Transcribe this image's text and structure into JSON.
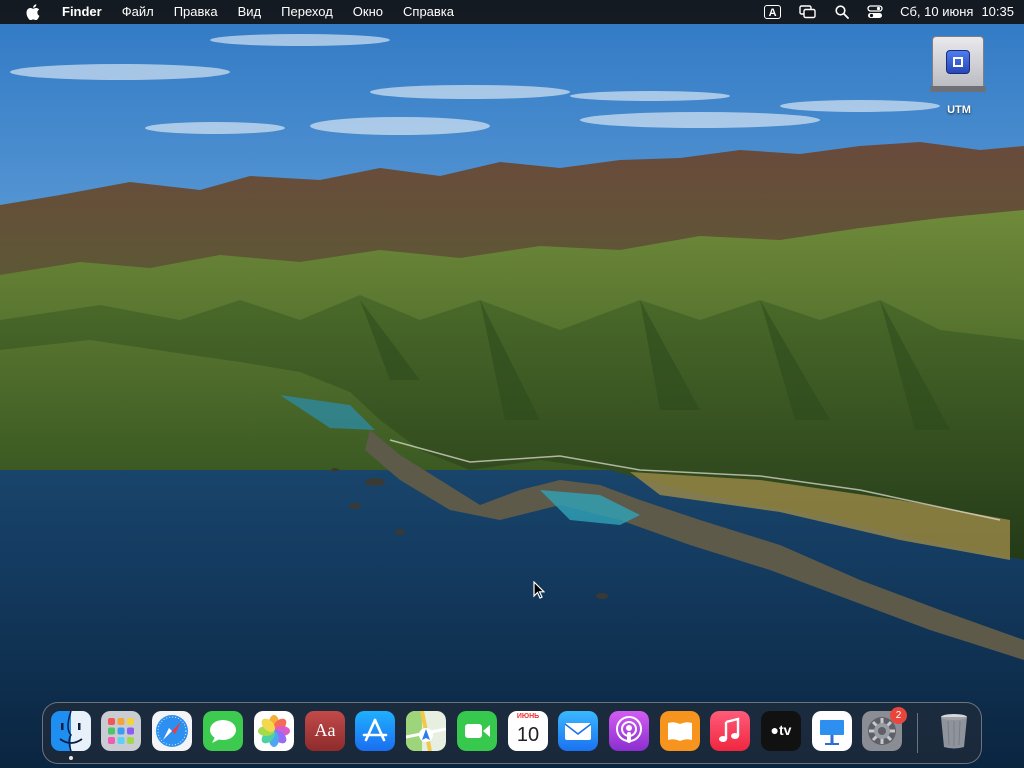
{
  "menubar": {
    "app_name": "Finder",
    "menus": [
      "Файл",
      "Правка",
      "Вид",
      "Переход",
      "Окно",
      "Справка"
    ],
    "input_source": "A",
    "date": "Сб, 10 июня",
    "time": "10:35",
    "icons": [
      "apple-icon",
      "keyboard-input-icon",
      "screen-mirroring-icon",
      "search-icon",
      "control-center-icon"
    ]
  },
  "desktop": {
    "drive_label": "UTM"
  },
  "dock": {
    "items": [
      {
        "name": "finder",
        "running": true
      },
      {
        "name": "launchpad"
      },
      {
        "name": "safari"
      },
      {
        "name": "messages"
      },
      {
        "name": "photos"
      },
      {
        "name": "dictionary",
        "glyph": "Aa"
      },
      {
        "name": "app-store"
      },
      {
        "name": "maps"
      },
      {
        "name": "facetime"
      },
      {
        "name": "calendar",
        "month": "ИЮНЬ",
        "day": "10"
      },
      {
        "name": "mail"
      },
      {
        "name": "podcasts"
      },
      {
        "name": "books"
      },
      {
        "name": "music"
      },
      {
        "name": "apple-tv",
        "glyph": "tv"
      },
      {
        "name": "keynote"
      },
      {
        "name": "system-preferences",
        "badge": "2"
      },
      {
        "name": "trash"
      }
    ]
  },
  "colors": {
    "menubar_bg": "#121214",
    "sky": "#4a8fd0",
    "ocean": "#0f3457",
    "mountains": "#4f6b2e",
    "badge": "#e8453c"
  }
}
